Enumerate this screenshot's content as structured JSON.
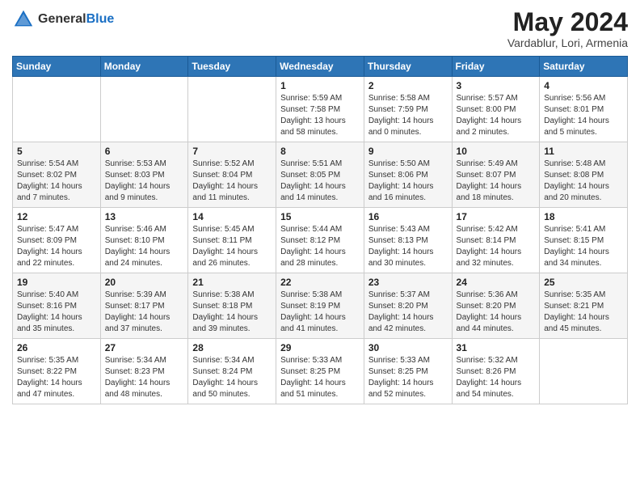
{
  "header": {
    "logo_general": "General",
    "logo_blue": "Blue",
    "month_title": "May 2024",
    "location": "Vardablur, Lori, Armenia"
  },
  "weekdays": [
    "Sunday",
    "Monday",
    "Tuesday",
    "Wednesday",
    "Thursday",
    "Friday",
    "Saturday"
  ],
  "weeks": [
    [
      {
        "day": "",
        "info": ""
      },
      {
        "day": "",
        "info": ""
      },
      {
        "day": "",
        "info": ""
      },
      {
        "day": "1",
        "info": "Sunrise: 5:59 AM\nSunset: 7:58 PM\nDaylight: 13 hours\nand 58 minutes."
      },
      {
        "day": "2",
        "info": "Sunrise: 5:58 AM\nSunset: 7:59 PM\nDaylight: 14 hours\nand 0 minutes."
      },
      {
        "day": "3",
        "info": "Sunrise: 5:57 AM\nSunset: 8:00 PM\nDaylight: 14 hours\nand 2 minutes."
      },
      {
        "day": "4",
        "info": "Sunrise: 5:56 AM\nSunset: 8:01 PM\nDaylight: 14 hours\nand 5 minutes."
      }
    ],
    [
      {
        "day": "5",
        "info": "Sunrise: 5:54 AM\nSunset: 8:02 PM\nDaylight: 14 hours\nand 7 minutes."
      },
      {
        "day": "6",
        "info": "Sunrise: 5:53 AM\nSunset: 8:03 PM\nDaylight: 14 hours\nand 9 minutes."
      },
      {
        "day": "7",
        "info": "Sunrise: 5:52 AM\nSunset: 8:04 PM\nDaylight: 14 hours\nand 11 minutes."
      },
      {
        "day": "8",
        "info": "Sunrise: 5:51 AM\nSunset: 8:05 PM\nDaylight: 14 hours\nand 14 minutes."
      },
      {
        "day": "9",
        "info": "Sunrise: 5:50 AM\nSunset: 8:06 PM\nDaylight: 14 hours\nand 16 minutes."
      },
      {
        "day": "10",
        "info": "Sunrise: 5:49 AM\nSunset: 8:07 PM\nDaylight: 14 hours\nand 18 minutes."
      },
      {
        "day": "11",
        "info": "Sunrise: 5:48 AM\nSunset: 8:08 PM\nDaylight: 14 hours\nand 20 minutes."
      }
    ],
    [
      {
        "day": "12",
        "info": "Sunrise: 5:47 AM\nSunset: 8:09 PM\nDaylight: 14 hours\nand 22 minutes."
      },
      {
        "day": "13",
        "info": "Sunrise: 5:46 AM\nSunset: 8:10 PM\nDaylight: 14 hours\nand 24 minutes."
      },
      {
        "day": "14",
        "info": "Sunrise: 5:45 AM\nSunset: 8:11 PM\nDaylight: 14 hours\nand 26 minutes."
      },
      {
        "day": "15",
        "info": "Sunrise: 5:44 AM\nSunset: 8:12 PM\nDaylight: 14 hours\nand 28 minutes."
      },
      {
        "day": "16",
        "info": "Sunrise: 5:43 AM\nSunset: 8:13 PM\nDaylight: 14 hours\nand 30 minutes."
      },
      {
        "day": "17",
        "info": "Sunrise: 5:42 AM\nSunset: 8:14 PM\nDaylight: 14 hours\nand 32 minutes."
      },
      {
        "day": "18",
        "info": "Sunrise: 5:41 AM\nSunset: 8:15 PM\nDaylight: 14 hours\nand 34 minutes."
      }
    ],
    [
      {
        "day": "19",
        "info": "Sunrise: 5:40 AM\nSunset: 8:16 PM\nDaylight: 14 hours\nand 35 minutes."
      },
      {
        "day": "20",
        "info": "Sunrise: 5:39 AM\nSunset: 8:17 PM\nDaylight: 14 hours\nand 37 minutes."
      },
      {
        "day": "21",
        "info": "Sunrise: 5:38 AM\nSunset: 8:18 PM\nDaylight: 14 hours\nand 39 minutes."
      },
      {
        "day": "22",
        "info": "Sunrise: 5:38 AM\nSunset: 8:19 PM\nDaylight: 14 hours\nand 41 minutes."
      },
      {
        "day": "23",
        "info": "Sunrise: 5:37 AM\nSunset: 8:20 PM\nDaylight: 14 hours\nand 42 minutes."
      },
      {
        "day": "24",
        "info": "Sunrise: 5:36 AM\nSunset: 8:20 PM\nDaylight: 14 hours\nand 44 minutes."
      },
      {
        "day": "25",
        "info": "Sunrise: 5:35 AM\nSunset: 8:21 PM\nDaylight: 14 hours\nand 45 minutes."
      }
    ],
    [
      {
        "day": "26",
        "info": "Sunrise: 5:35 AM\nSunset: 8:22 PM\nDaylight: 14 hours\nand 47 minutes."
      },
      {
        "day": "27",
        "info": "Sunrise: 5:34 AM\nSunset: 8:23 PM\nDaylight: 14 hours\nand 48 minutes."
      },
      {
        "day": "28",
        "info": "Sunrise: 5:34 AM\nSunset: 8:24 PM\nDaylight: 14 hours\nand 50 minutes."
      },
      {
        "day": "29",
        "info": "Sunrise: 5:33 AM\nSunset: 8:25 PM\nDaylight: 14 hours\nand 51 minutes."
      },
      {
        "day": "30",
        "info": "Sunrise: 5:33 AM\nSunset: 8:25 PM\nDaylight: 14 hours\nand 52 minutes."
      },
      {
        "day": "31",
        "info": "Sunrise: 5:32 AM\nSunset: 8:26 PM\nDaylight: 14 hours\nand 54 minutes."
      },
      {
        "day": "",
        "info": ""
      }
    ]
  ]
}
